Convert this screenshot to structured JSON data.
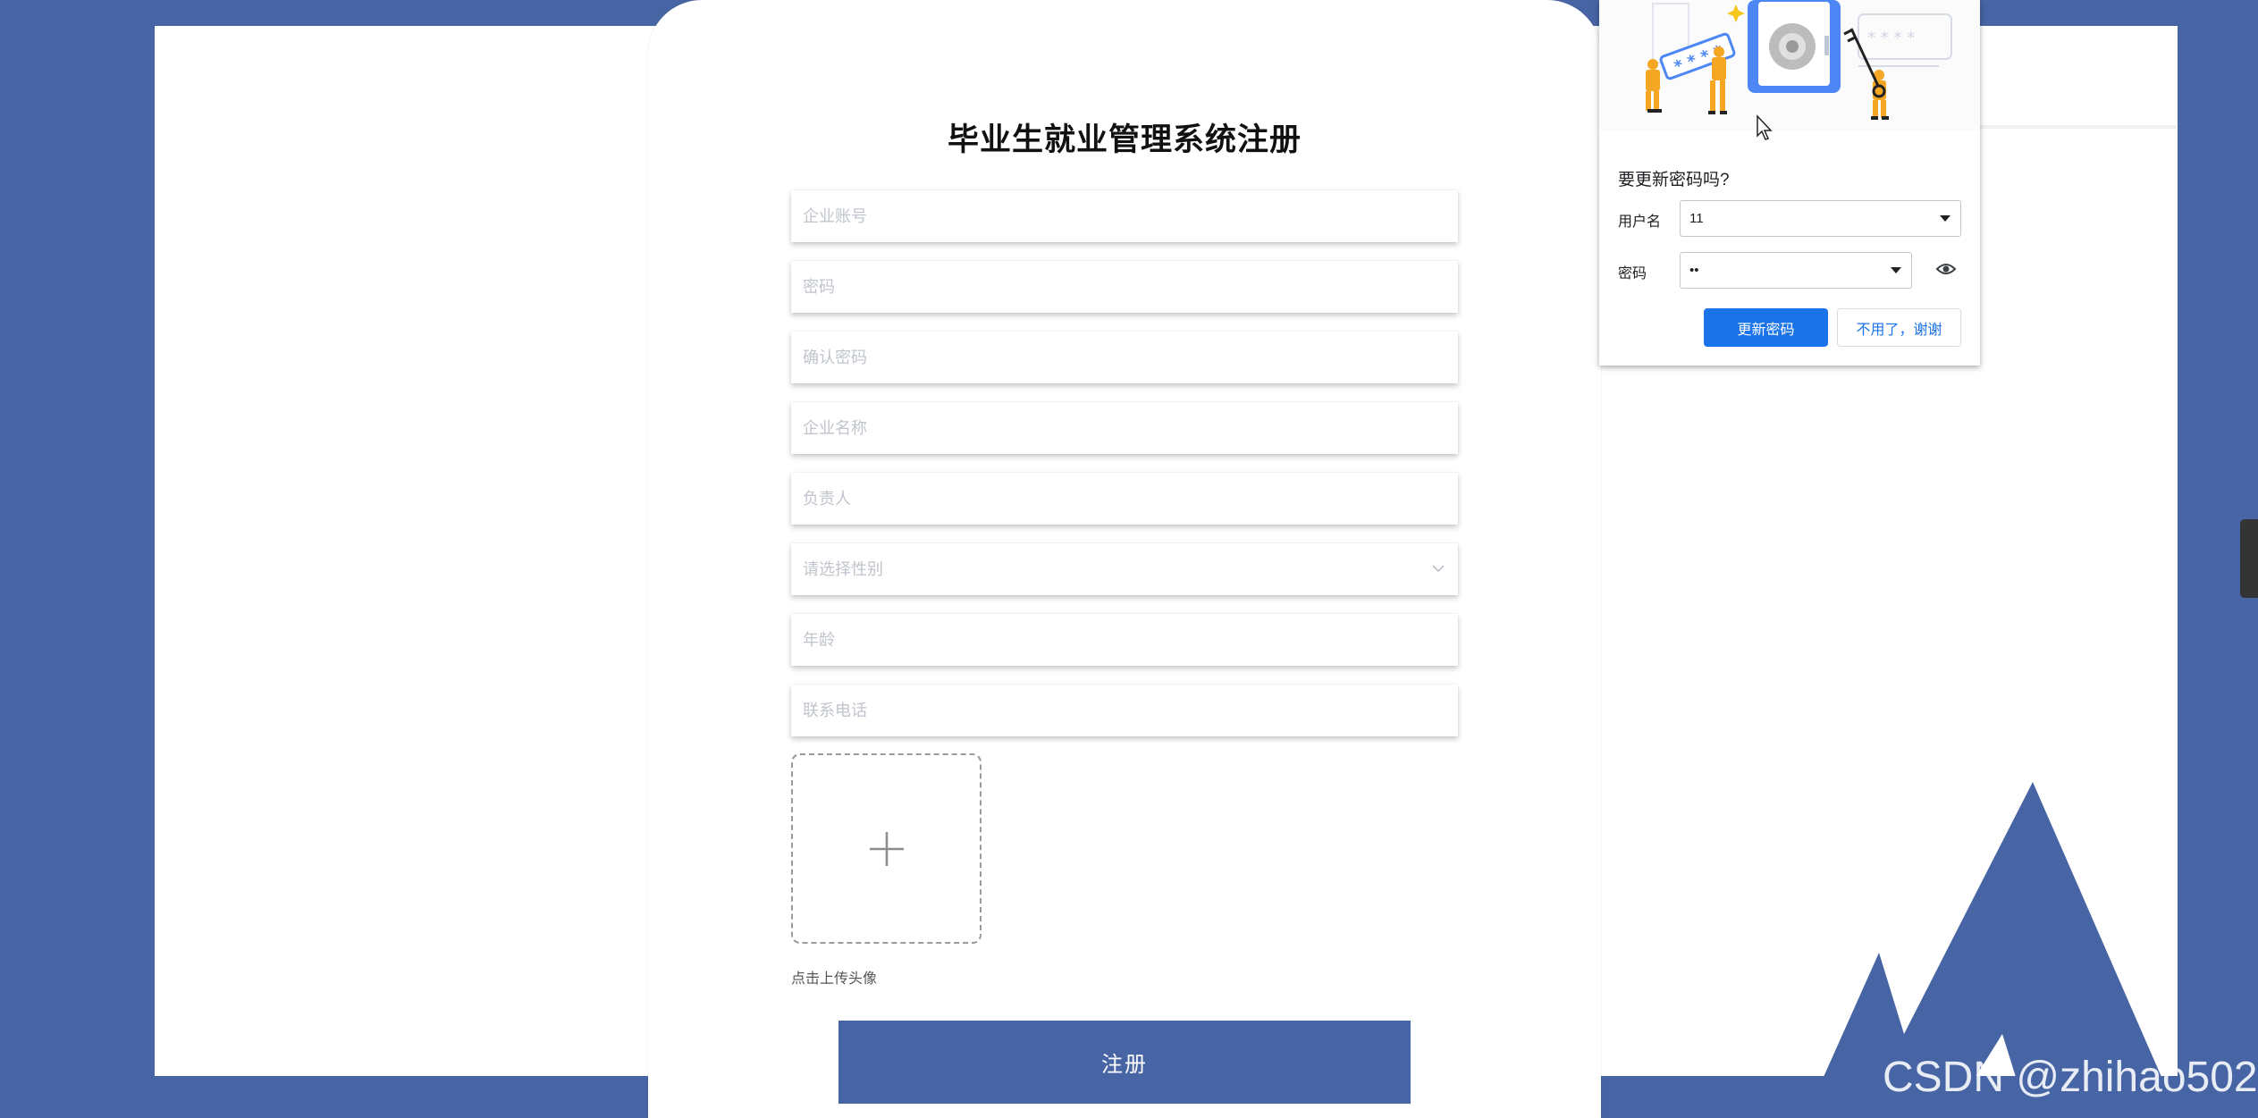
{
  "form": {
    "title": "毕业生就业管理系统注册",
    "fields": {
      "account": {
        "placeholder": "企业账号",
        "value": ""
      },
      "password": {
        "placeholder": "密码",
        "value": ""
      },
      "confirm_password": {
        "placeholder": "确认密码",
        "value": ""
      },
      "company_name": {
        "placeholder": "企业名称",
        "value": ""
      },
      "contact_person": {
        "placeholder": "负责人",
        "value": ""
      },
      "gender": {
        "placeholder": "请选择性别",
        "value": ""
      },
      "age": {
        "placeholder": "年龄",
        "value": ""
      },
      "phone": {
        "placeholder": "联系电话",
        "value": ""
      }
    },
    "upload_label": "点击上传头像",
    "register_label": "注册"
  },
  "password_popup": {
    "question": "要更新密码吗?",
    "username_label": "用户名",
    "username_value": "11",
    "password_label": "密码",
    "password_value": "••",
    "update_label": "更新密码",
    "dismiss_label": "不用了，谢谢"
  },
  "watermark": "CSDN @zhihao502",
  "colors": {
    "background": "#4764a4",
    "register_button": "#4764a4",
    "popup_primary": "#1a73e8"
  }
}
